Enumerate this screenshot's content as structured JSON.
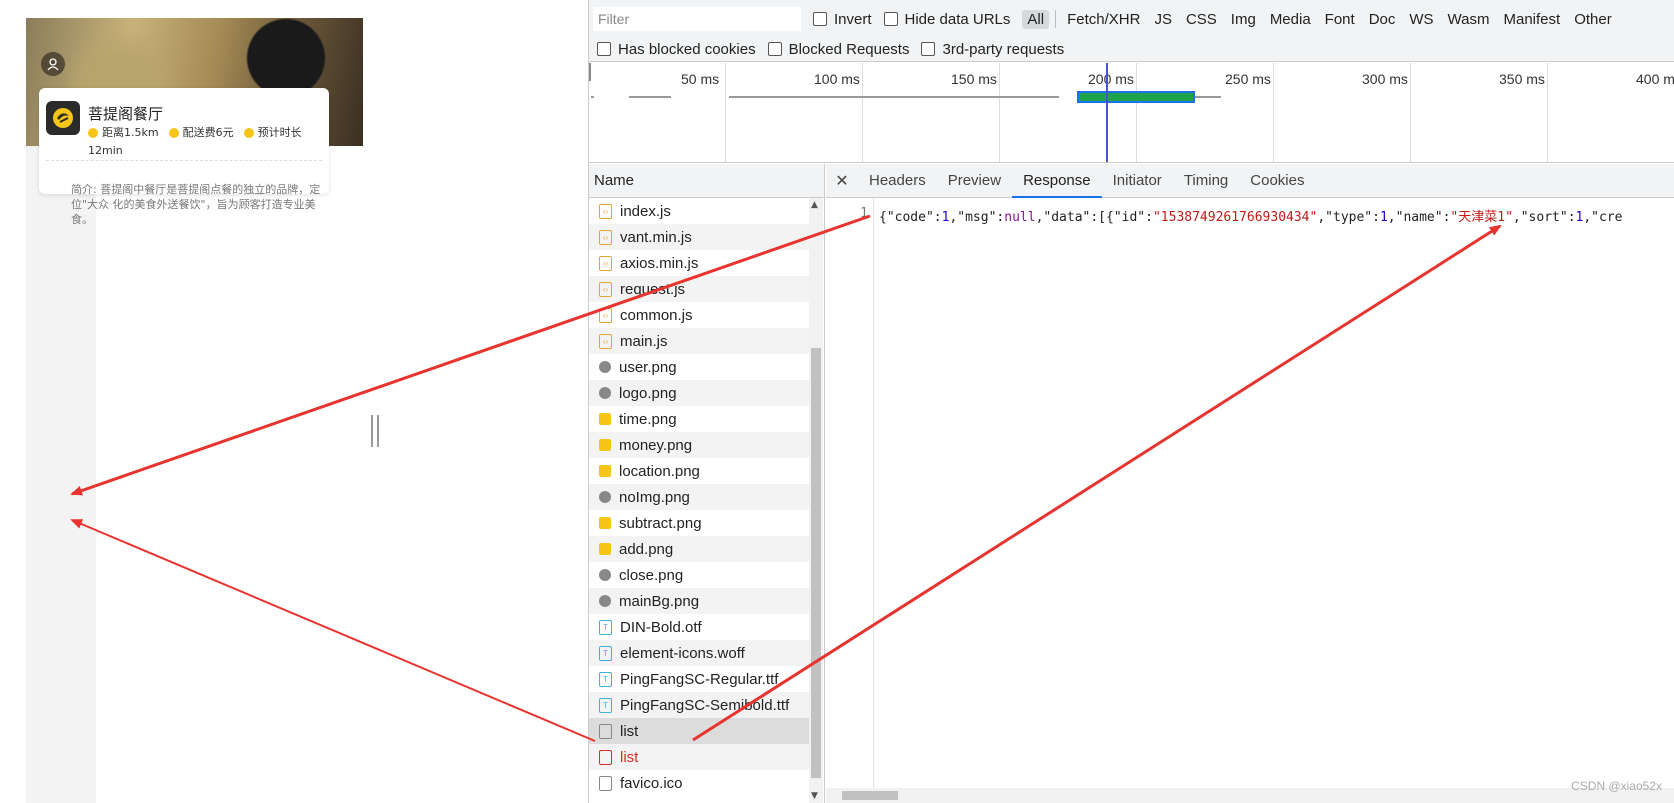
{
  "phone": {
    "shop_name": "菩提阁餐厅",
    "meta": {
      "distance": "距离1.5km",
      "delivery_fee": "配送费6元",
      "eta_label": "预计时长",
      "eta_value": "12min"
    },
    "intro": "简介: 菩提阁中餐厅是菩提阁点餐的独立的品牌，定位\"大众 化的美食外送餐饮\"，旨为顾客打造专业美食。"
  },
  "filter_bar": {
    "filter_placeholder": "Filter",
    "invert": "Invert",
    "hide_data_urls": "Hide data URLs",
    "types": [
      "All",
      "Fetch/XHR",
      "JS",
      "CSS",
      "Img",
      "Media",
      "Font",
      "Doc",
      "WS",
      "Wasm",
      "Manifest",
      "Other"
    ],
    "active_type": "All",
    "has_blocked_cookies": "Has blocked cookies",
    "blocked_requests": "Blocked Requests",
    "third_party": "3rd-party requests"
  },
  "overview": {
    "ticks": [
      "50 ms",
      "100 ms",
      "150 ms",
      "200 ms",
      "250 ms",
      "300 ms",
      "350 ms",
      "400 ms"
    ]
  },
  "name_panel": {
    "header": "Name",
    "files": [
      {
        "name": "index.js",
        "kind": "script"
      },
      {
        "name": "vant.min.js",
        "kind": "script"
      },
      {
        "name": "axios.min.js",
        "kind": "script"
      },
      {
        "name": "request.js",
        "kind": "script"
      },
      {
        "name": "common.js",
        "kind": "script"
      },
      {
        "name": "main.js",
        "kind": "script"
      },
      {
        "name": "user.png",
        "kind": "image"
      },
      {
        "name": "logo.png",
        "kind": "image"
      },
      {
        "name": "time.png",
        "kind": "image-y"
      },
      {
        "name": "money.png",
        "kind": "image-y"
      },
      {
        "name": "location.png",
        "kind": "image-y"
      },
      {
        "name": "noImg.png",
        "kind": "image"
      },
      {
        "name": "subtract.png",
        "kind": "image-y"
      },
      {
        "name": "add.png",
        "kind": "image-y"
      },
      {
        "name": "close.png",
        "kind": "image"
      },
      {
        "name": "mainBg.png",
        "kind": "image"
      },
      {
        "name": "DIN-Bold.otf",
        "kind": "font"
      },
      {
        "name": "element-icons.woff",
        "kind": "font"
      },
      {
        "name": "PingFangSC-Regular.ttf",
        "kind": "font"
      },
      {
        "name": "PingFangSC-Semibold.ttf",
        "kind": "font"
      },
      {
        "name": "list",
        "kind": "doc",
        "selected": true
      },
      {
        "name": "list",
        "kind": "doc-red",
        "error": true
      },
      {
        "name": "favico.ico",
        "kind": "doc"
      }
    ]
  },
  "detail_panel": {
    "tabs": [
      "Headers",
      "Preview",
      "Response",
      "Initiator",
      "Timing",
      "Cookies"
    ],
    "active_tab": "Response",
    "line_number": "1",
    "response": {
      "p1": "{\"code\":",
      "v1": "1",
      "p2": ",\"msg\":",
      "v2": "null",
      "p3": ",\"data\":[{\"id\":",
      "v3": "\"1538749261766930434\"",
      "p4": ",\"type\":",
      "v4": "1",
      "p5": ",\"name\":",
      "v5": "\"天津菜1\"",
      "p6": ",\"sort\":",
      "v6": "1",
      "p7": ",\"cre"
    }
  },
  "watermark": "CSDN @xiao52x",
  "colors": {
    "accent": "#1a73e8",
    "arrow": "#e8342f",
    "error": "#d93025",
    "brand_yellow": "#f5c518"
  }
}
